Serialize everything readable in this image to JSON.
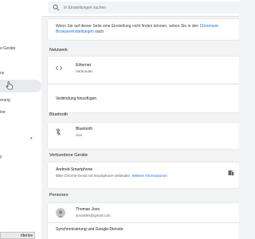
{
  "sidebar": {
    "items": [
      {
        "label": "e Geräte"
      },
      {
        "label": "ns"
      },
      {
        "label": "erung"
      },
      {
        "label": "ine"
      },
      {
        "label": "y"
      }
    ],
    "dropdown_arrow": "▾",
    "bottom_label": "rderice"
  },
  "search": {
    "placeholder": "In Einstellungen suchen",
    "icon": "search-icon"
  },
  "notice": {
    "text_before": "Wenn Sie auf dieser Seite eine Einstellung nicht finden können, sehen Sie in den ",
    "link": "Chromium-Browsereinstellungen",
    "text_after": " nach"
  },
  "network": {
    "title": "Netzwerk",
    "ethernet_title": "Ethernet",
    "ethernet_status": "Verbunden",
    "add_connection": "Verbindung hinzufügen"
  },
  "bluetooth": {
    "title": "Bluetooth",
    "row_title": "Bluetooth",
    "row_status": "Aus"
  },
  "devices": {
    "title": "Verbundene Geräte",
    "row_title": "Android-Smartphone",
    "row_desc": "Bitte Chrome-Gerät mit Smartphone verbinden.",
    "row_link": "Weitere Informationen"
  },
  "people": {
    "title": "Personen",
    "name": "Thomas Joos",
    "email": "smorafes@gmail.com",
    "sync": "Synchronisierung und Google-Dienste"
  },
  "colors": {
    "accent": "#1a73e8",
    "background": "#f1f3f4",
    "card": "#ffffff"
  }
}
